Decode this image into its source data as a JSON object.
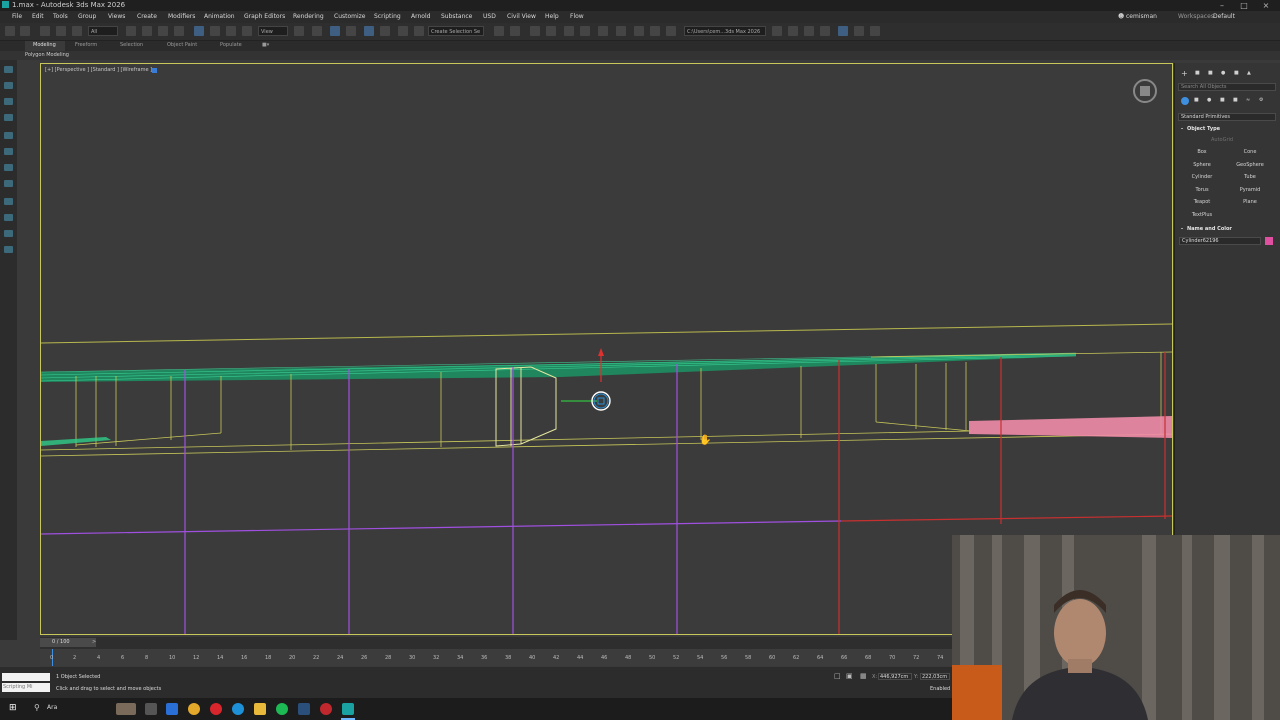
{
  "window": {
    "title": "1.max - Autodesk 3ds Max 2026",
    "controls": [
      "minimize-icon",
      "maximize-icon",
      "close-icon"
    ]
  },
  "menubar": {
    "items": [
      "File",
      "Edit",
      "Tools",
      "Group",
      "Views",
      "Create",
      "Modifiers",
      "Animation",
      "Graph Editors",
      "Rendering",
      "Customize",
      "Scripting",
      "Arnold",
      "Substance",
      "USD",
      "Civil View",
      "Help",
      "Flow"
    ],
    "user": "cemisman",
    "workspaces_label": "Workspaces:",
    "workspace": "Default"
  },
  "toolbar": {
    "filter": "All",
    "view_dropdown": "View",
    "selection_set": "Create Selection Se",
    "path": "C:\\Users\\cem...3ds Max 2026"
  },
  "ribbon": {
    "tabs": [
      "Modeling",
      "Freeform",
      "Selection",
      "Object Paint",
      "Populate"
    ],
    "active_panel": "Polygon Modeling"
  },
  "viewport": {
    "label": "[+] [Perspective ] [Standard ] [Wireframe ]",
    "colors": {
      "border": "#c8c85a",
      "green": "#2fcf8a",
      "yellow": "#c8c85a",
      "purple": "#a050e0",
      "red": "#c83030",
      "pink": "#f08ca8"
    }
  },
  "command_panel": {
    "search_placeholder": "Search All Objects",
    "category": "Standard Primitives",
    "object_type_header": "Object Type",
    "autogrid": "AutoGrid",
    "buttons": [
      "Box",
      "Cone",
      "Sphere",
      "GeoSphere",
      "Cylinder",
      "Tube",
      "Torus",
      "Pyramid",
      "Teapot",
      "Plane",
      "TextPlus"
    ],
    "name_color_header": "Name and Color",
    "object_name": "Cylinder62196",
    "object_color": "#e050a0"
  },
  "timeline": {
    "frame_display": "0 / 100",
    "ticks": [
      "0",
      "2",
      "4",
      "6",
      "8",
      "10",
      "12",
      "14",
      "16",
      "18",
      "20",
      "22",
      "24",
      "26",
      "28",
      "30",
      "32",
      "34",
      "36",
      "38",
      "40",
      "42",
      "44",
      "46",
      "48",
      "50",
      "52",
      "54",
      "56",
      "58",
      "60",
      "62",
      "64",
      "66",
      "68",
      "70",
      "72",
      "74"
    ]
  },
  "status": {
    "maxscript": "Scripting Mi",
    "selection": "1 Object Selected",
    "prompt": "Click and drag to select and move objects",
    "x_field": "446,927cm",
    "y_field": "222,03cm",
    "enabled": "Enabled"
  },
  "taskbar": {
    "search": "Ara"
  }
}
